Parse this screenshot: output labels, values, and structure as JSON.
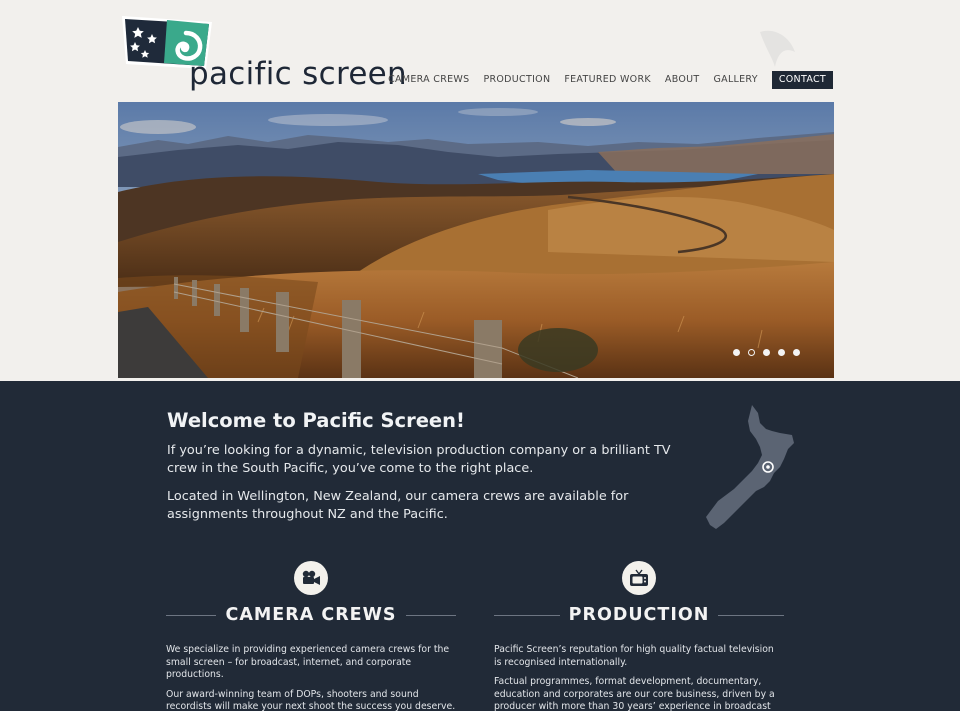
{
  "brand": {
    "name": "pacific screen"
  },
  "nav": {
    "items": [
      "CAMERA CREWS",
      "PRODUCTION",
      "FEATURED WORK",
      "ABOUT",
      "GALLERY"
    ],
    "active": "CONTACT"
  },
  "hero": {
    "slide_count": 5,
    "active_slide": 2
  },
  "welcome": {
    "title": "Welcome to Pacific Screen!",
    "p1": "If you’re looking for a dynamic, television production company or a brilliant TV crew in the South Pacific, you’ve come to the right place.",
    "p2": "Located in Wellington, New Zealand, our camera crews are available for assignments throughout NZ and the Pacific."
  },
  "columns": {
    "camera": {
      "icon": "camera-icon",
      "heading": "CAMERA CREWS",
      "p1": "We specialize in providing experienced camera crews for the small screen – for broadcast, internet, and corporate productions.",
      "p2": "Our award-winning team of DOPs, shooters and sound recordists will make your next shoot the success you deserve."
    },
    "production": {
      "icon": "television-icon",
      "heading": "PRODUCTION",
      "p1": "Pacific Screen’s reputation for high quality factual television is recognised internationally.",
      "p2": "Factual programmes, format development, documentary, education and corporates are our core business, driven by a producer with more than 30 years’ experience in broadcast"
    }
  },
  "colors": {
    "navy": "#212a37",
    "accent": "#3aa98b",
    "background": "#f2f0ed"
  }
}
